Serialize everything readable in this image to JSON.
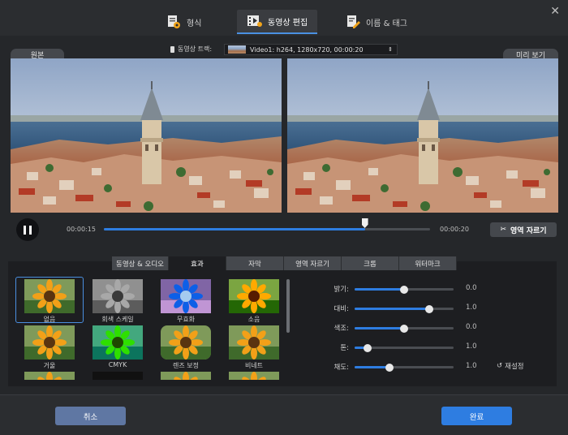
{
  "top_tabs": [
    {
      "label": "형식",
      "icon": "format-settings-icon"
    },
    {
      "label": "동영상 편집",
      "icon": "video-edit-icon",
      "active": true
    },
    {
      "label": "이름 & 태그",
      "icon": "name-tag-edit-icon"
    }
  ],
  "preview": {
    "original_label": "원본",
    "preview_label": "미리 보기",
    "track_label": "동영상 트랙:",
    "track_value": "Video1: h264, 1280x720, 00:00:20"
  },
  "player": {
    "current_time": "00:00:15",
    "total_time": "00:00:20",
    "progress": 0.8,
    "crop_label": "영역 자르기"
  },
  "edit_tabs": [
    {
      "label": "동영상 & 오디오"
    },
    {
      "label": "효과",
      "active": true
    },
    {
      "label": "자막"
    },
    {
      "label": "영역 자르기"
    },
    {
      "label": "크롭"
    },
    {
      "label": "워터마크"
    }
  ],
  "effects": [
    {
      "label": "없음",
      "selected": true
    },
    {
      "label": "회색 스케일"
    },
    {
      "label": "무효화"
    },
    {
      "label": "소음"
    },
    {
      "label": "거울"
    },
    {
      "label": "CMYK"
    },
    {
      "label": "렌즈 보정"
    },
    {
      "label": "비네트"
    }
  ],
  "adjustments": [
    {
      "label": "밝기:",
      "value": "0.0",
      "fraction": 0.5
    },
    {
      "label": "대비:",
      "value": "1.0",
      "fraction": 0.75
    },
    {
      "label": "색조:",
      "value": "0.0",
      "fraction": 0.5
    },
    {
      "label": "톤:",
      "value": "1.0",
      "fraction": 0.13
    },
    {
      "label": "채도:",
      "value": "1.0",
      "fraction": 0.35
    }
  ],
  "reset_label": "재설정",
  "footer": {
    "cancel_label": "취소",
    "done_label": "완료"
  },
  "colors": {
    "accent": "#2e7de1",
    "panel": "#25272a",
    "cancel": "#5f77a3"
  }
}
